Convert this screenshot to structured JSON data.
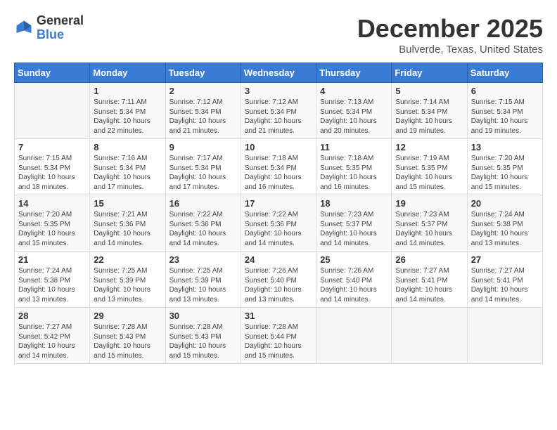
{
  "header": {
    "logo_general": "General",
    "logo_blue": "Blue",
    "month_title": "December 2025",
    "location": "Bulverde, Texas, United States"
  },
  "calendar": {
    "days_of_week": [
      "Sunday",
      "Monday",
      "Tuesday",
      "Wednesday",
      "Thursday",
      "Friday",
      "Saturday"
    ],
    "weeks": [
      [
        {
          "day": "",
          "info": ""
        },
        {
          "day": "1",
          "info": "Sunrise: 7:11 AM\nSunset: 5:34 PM\nDaylight: 10 hours\nand 22 minutes."
        },
        {
          "day": "2",
          "info": "Sunrise: 7:12 AM\nSunset: 5:34 PM\nDaylight: 10 hours\nand 21 minutes."
        },
        {
          "day": "3",
          "info": "Sunrise: 7:12 AM\nSunset: 5:34 PM\nDaylight: 10 hours\nand 21 minutes."
        },
        {
          "day": "4",
          "info": "Sunrise: 7:13 AM\nSunset: 5:34 PM\nDaylight: 10 hours\nand 20 minutes."
        },
        {
          "day": "5",
          "info": "Sunrise: 7:14 AM\nSunset: 5:34 PM\nDaylight: 10 hours\nand 19 minutes."
        },
        {
          "day": "6",
          "info": "Sunrise: 7:15 AM\nSunset: 5:34 PM\nDaylight: 10 hours\nand 19 minutes."
        }
      ],
      [
        {
          "day": "7",
          "info": "Sunrise: 7:15 AM\nSunset: 5:34 PM\nDaylight: 10 hours\nand 18 minutes."
        },
        {
          "day": "8",
          "info": "Sunrise: 7:16 AM\nSunset: 5:34 PM\nDaylight: 10 hours\nand 17 minutes."
        },
        {
          "day": "9",
          "info": "Sunrise: 7:17 AM\nSunset: 5:34 PM\nDaylight: 10 hours\nand 17 minutes."
        },
        {
          "day": "10",
          "info": "Sunrise: 7:18 AM\nSunset: 5:34 PM\nDaylight: 10 hours\nand 16 minutes."
        },
        {
          "day": "11",
          "info": "Sunrise: 7:18 AM\nSunset: 5:35 PM\nDaylight: 10 hours\nand 16 minutes."
        },
        {
          "day": "12",
          "info": "Sunrise: 7:19 AM\nSunset: 5:35 PM\nDaylight: 10 hours\nand 15 minutes."
        },
        {
          "day": "13",
          "info": "Sunrise: 7:20 AM\nSunset: 5:35 PM\nDaylight: 10 hours\nand 15 minutes."
        }
      ],
      [
        {
          "day": "14",
          "info": "Sunrise: 7:20 AM\nSunset: 5:35 PM\nDaylight: 10 hours\nand 15 minutes."
        },
        {
          "day": "15",
          "info": "Sunrise: 7:21 AM\nSunset: 5:36 PM\nDaylight: 10 hours\nand 14 minutes."
        },
        {
          "day": "16",
          "info": "Sunrise: 7:22 AM\nSunset: 5:36 PM\nDaylight: 10 hours\nand 14 minutes."
        },
        {
          "day": "17",
          "info": "Sunrise: 7:22 AM\nSunset: 5:36 PM\nDaylight: 10 hours\nand 14 minutes."
        },
        {
          "day": "18",
          "info": "Sunrise: 7:23 AM\nSunset: 5:37 PM\nDaylight: 10 hours\nand 14 minutes."
        },
        {
          "day": "19",
          "info": "Sunrise: 7:23 AM\nSunset: 5:37 PM\nDaylight: 10 hours\nand 14 minutes."
        },
        {
          "day": "20",
          "info": "Sunrise: 7:24 AM\nSunset: 5:38 PM\nDaylight: 10 hours\nand 13 minutes."
        }
      ],
      [
        {
          "day": "21",
          "info": "Sunrise: 7:24 AM\nSunset: 5:38 PM\nDaylight: 10 hours\nand 13 minutes."
        },
        {
          "day": "22",
          "info": "Sunrise: 7:25 AM\nSunset: 5:39 PM\nDaylight: 10 hours\nand 13 minutes."
        },
        {
          "day": "23",
          "info": "Sunrise: 7:25 AM\nSunset: 5:39 PM\nDaylight: 10 hours\nand 13 minutes."
        },
        {
          "day": "24",
          "info": "Sunrise: 7:26 AM\nSunset: 5:40 PM\nDaylight: 10 hours\nand 13 minutes."
        },
        {
          "day": "25",
          "info": "Sunrise: 7:26 AM\nSunset: 5:40 PM\nDaylight: 10 hours\nand 14 minutes."
        },
        {
          "day": "26",
          "info": "Sunrise: 7:27 AM\nSunset: 5:41 PM\nDaylight: 10 hours\nand 14 minutes."
        },
        {
          "day": "27",
          "info": "Sunrise: 7:27 AM\nSunset: 5:41 PM\nDaylight: 10 hours\nand 14 minutes."
        }
      ],
      [
        {
          "day": "28",
          "info": "Sunrise: 7:27 AM\nSunset: 5:42 PM\nDaylight: 10 hours\nand 14 minutes."
        },
        {
          "day": "29",
          "info": "Sunrise: 7:28 AM\nSunset: 5:43 PM\nDaylight: 10 hours\nand 15 minutes."
        },
        {
          "day": "30",
          "info": "Sunrise: 7:28 AM\nSunset: 5:43 PM\nDaylight: 10 hours\nand 15 minutes."
        },
        {
          "day": "31",
          "info": "Sunrise: 7:28 AM\nSunset: 5:44 PM\nDaylight: 10 hours\nand 15 minutes."
        },
        {
          "day": "",
          "info": ""
        },
        {
          "day": "",
          "info": ""
        },
        {
          "day": "",
          "info": ""
        }
      ]
    ]
  }
}
